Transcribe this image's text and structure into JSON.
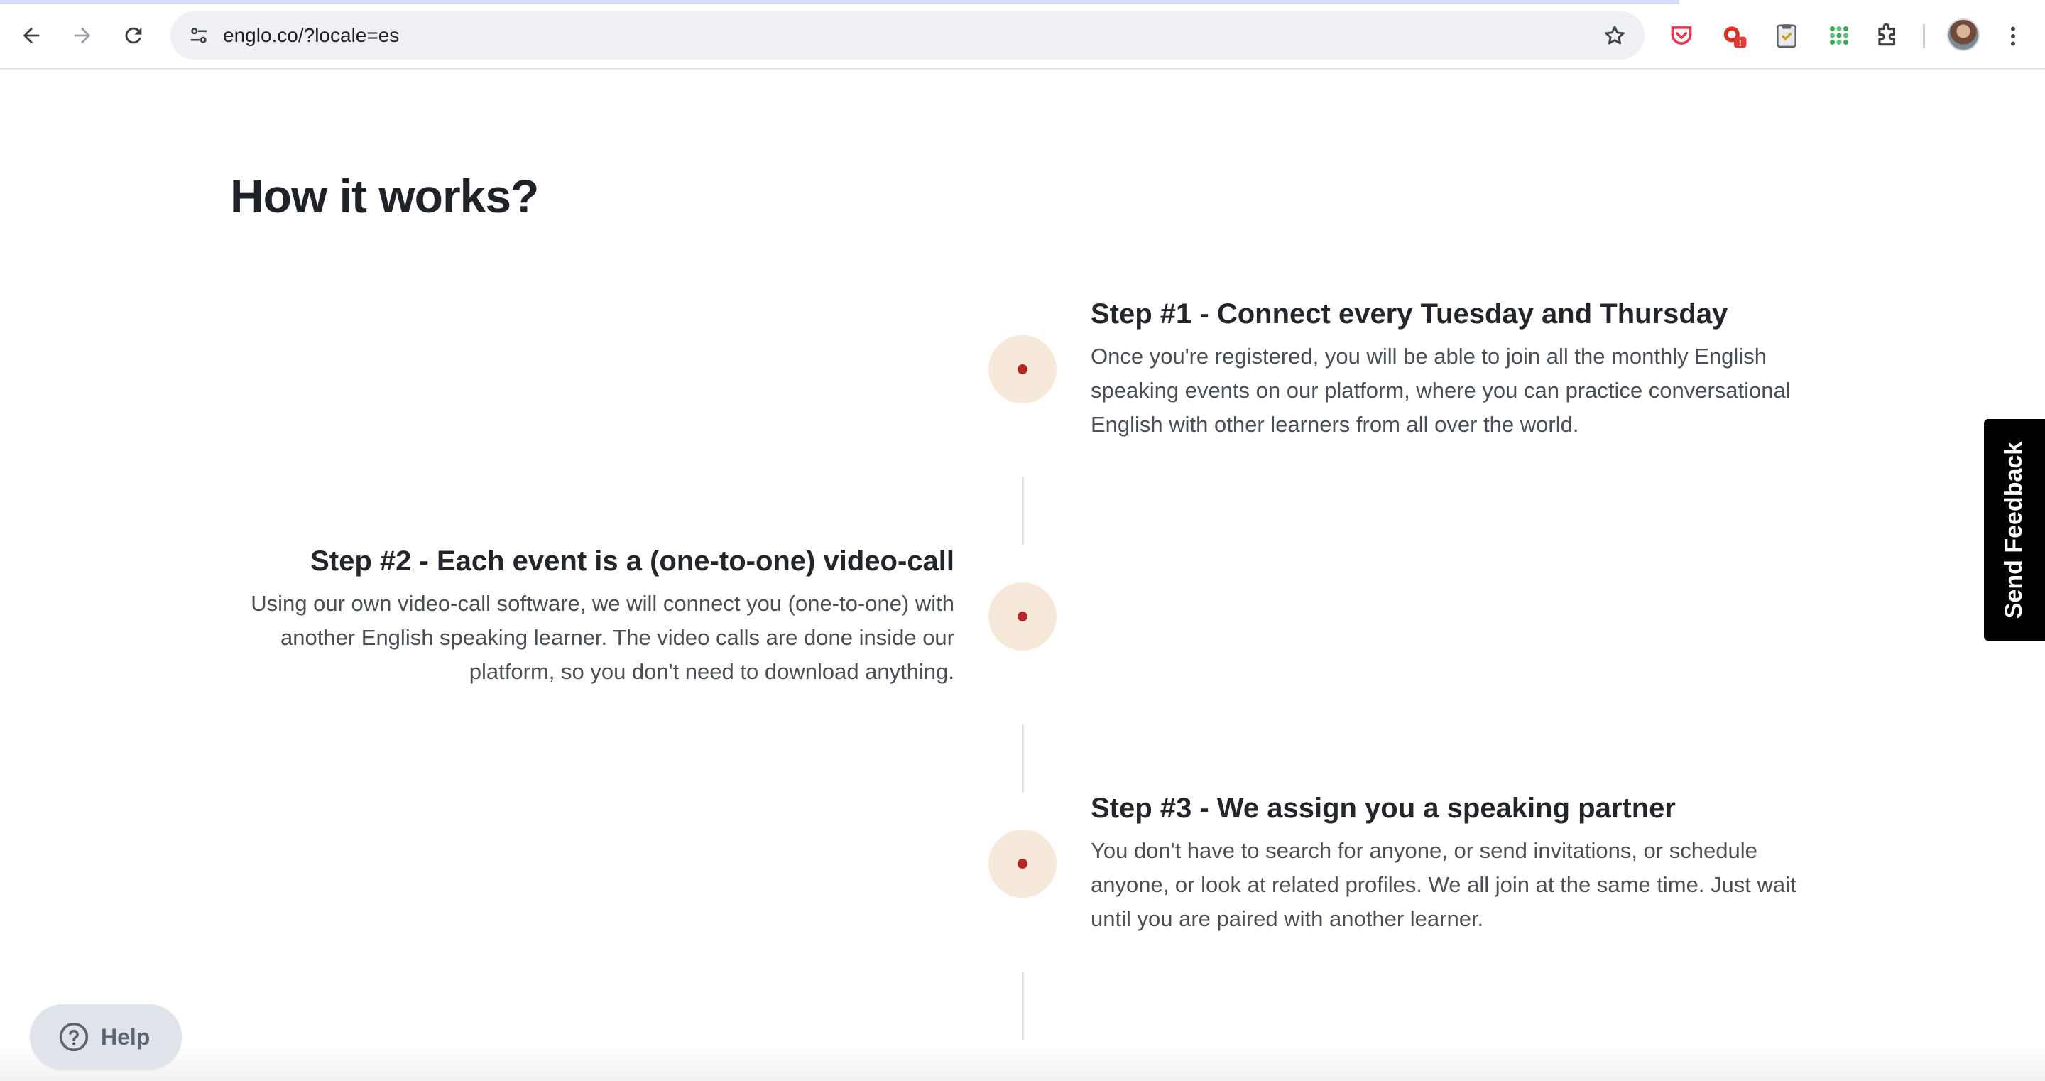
{
  "browser": {
    "url": "englo.co/?locale=es",
    "back_icon": "arrow-left",
    "forward_icon": "arrow-right",
    "reload_icon": "reload",
    "site_info_icon": "tune",
    "bookmark_icon": "star-outline",
    "extensions": [
      "pocket-icon",
      "alert-extension-icon",
      "clipboard-extension-icon",
      "grid-dots-extension-icon",
      "puzzle-icon"
    ],
    "alert_badge": "!"
  },
  "page": {
    "title": "How it works?",
    "steps": [
      {
        "title": "Step #1 - Connect every Tuesday and Thursday",
        "body": "Once you're registered, you will be able to join all the monthly English speaking events on our platform, where you can practice conversational English with other learners from all over the world."
      },
      {
        "title": "Step #2 - Each event is a (one-to-one) video-call",
        "body": "Using our own video-call software, we will connect you (one-to-one) with another English speaking learner. The video calls are done inside our platform, so you don't need to download anything."
      },
      {
        "title": "Step #3 - We assign you a speaking partner",
        "body": "You don't have to search for anyone, or send invitations, or schedule anyone, or look at related profiles. We all join at the same time. Just wait until you are paired with another learner."
      }
    ],
    "feedback_label": "Send Feedback",
    "help_label": "Help"
  },
  "colors": {
    "dot_fill": "#f7e9da",
    "dot_center": "#b12a2a",
    "heading": "#1f2328",
    "body_text": "#4a4f55",
    "feedback_bg": "#000000",
    "help_bg": "#dfe3ea"
  }
}
